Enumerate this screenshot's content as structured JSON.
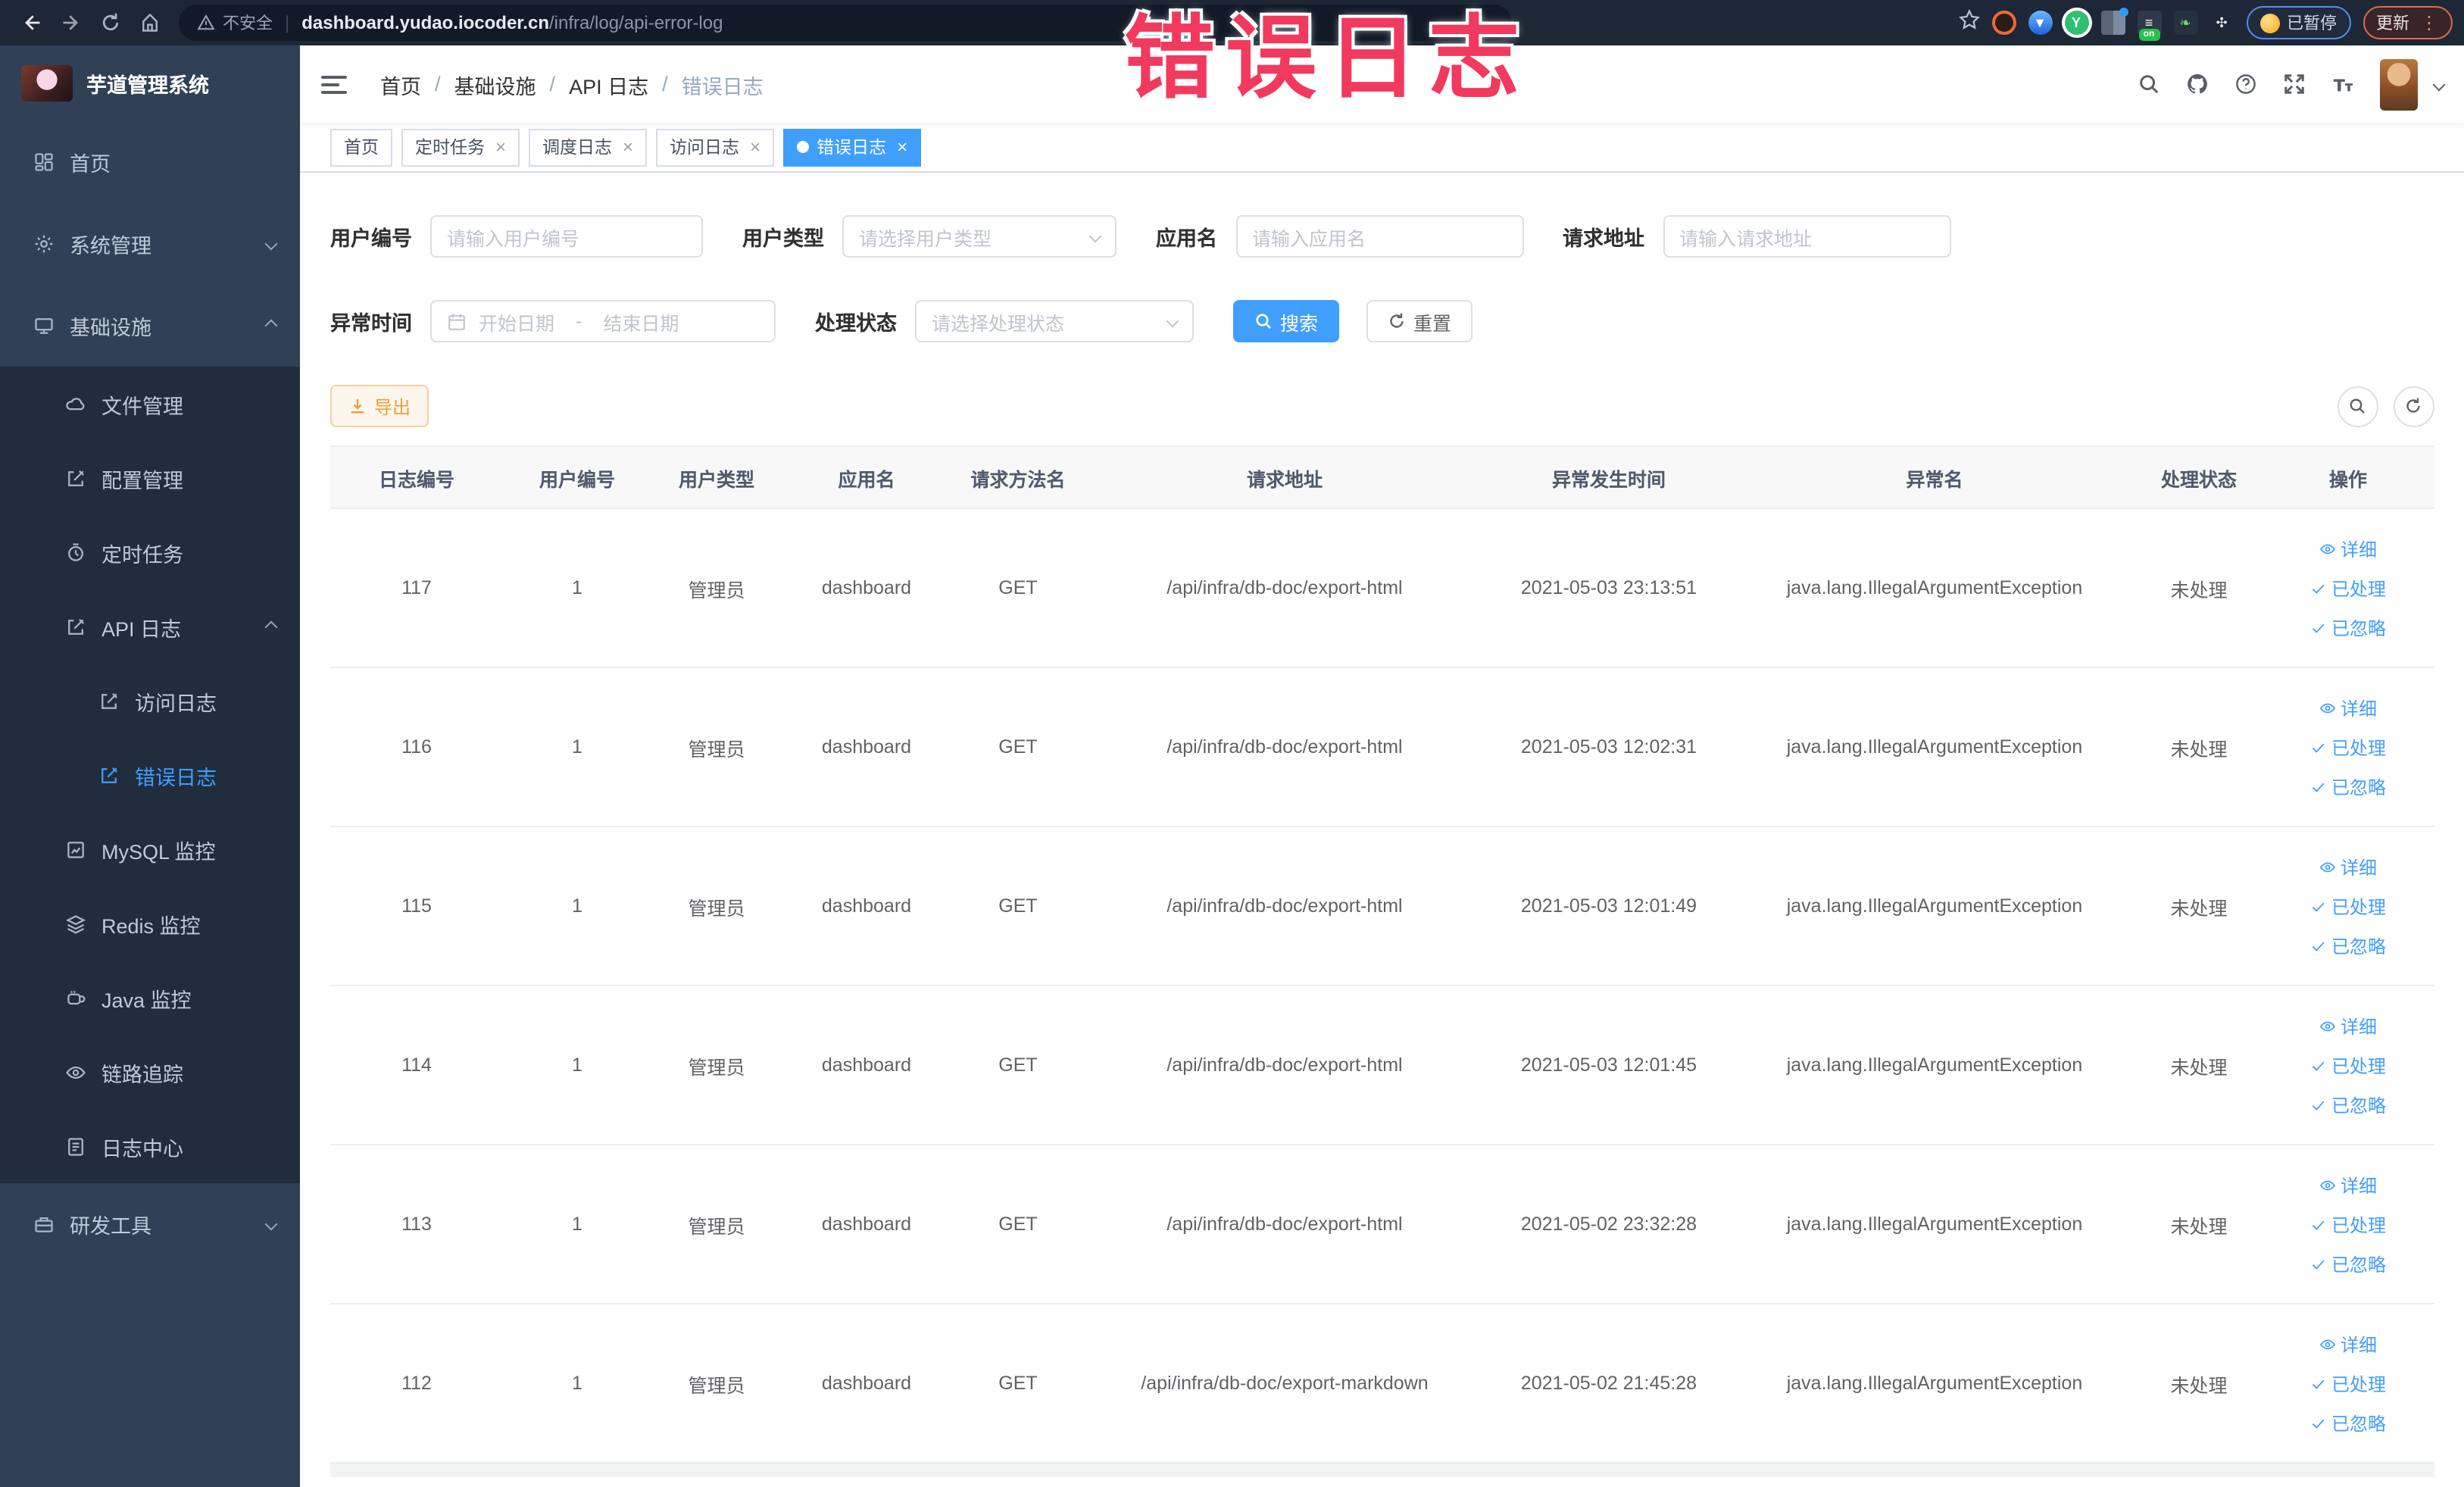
{
  "colors": {
    "accent": "#409eff",
    "warning": "#e6a23c",
    "stamp": "#f13a5e",
    "sidebar_bg": "#304156",
    "submenu_bg": "#1f2d3d"
  },
  "browser": {
    "security_label": "不安全",
    "url_domain": "dashboard.yudao.iocoder.cn",
    "url_path": "/infra/log/api-error-log",
    "paused_badge": "已暂停",
    "update_button": "更新"
  },
  "overlay_stamp": "错误日志",
  "sidebar": {
    "title": "芋道管理系统",
    "menu": [
      {
        "label": "首页",
        "icon": "dashboard-icon",
        "level": 1
      },
      {
        "label": "系统管理",
        "icon": "gear-icon",
        "level": 1,
        "chevron": "down"
      },
      {
        "label": "基础设施",
        "icon": "monitor-icon",
        "level": 1,
        "chevron": "up"
      },
      {
        "label": "文件管理",
        "icon": "cloud-icon",
        "level": 2
      },
      {
        "label": "配置管理",
        "icon": "edit-icon",
        "level": 2
      },
      {
        "label": "定时任务",
        "icon": "timer-icon",
        "level": 2
      },
      {
        "label": "API 日志",
        "icon": "edit-icon",
        "level": 2,
        "chevron": "up"
      },
      {
        "label": "访问日志",
        "icon": "edit-icon",
        "level": 3
      },
      {
        "label": "错误日志",
        "icon": "edit-icon",
        "level": 3,
        "active": true
      },
      {
        "label": "MySQL 监控",
        "icon": "database-icon",
        "level": 2
      },
      {
        "label": "Redis 监控",
        "icon": "layers-icon",
        "level": 2
      },
      {
        "label": "Java 监控",
        "icon": "coffee-icon",
        "level": 2
      },
      {
        "label": "链路追踪",
        "icon": "eye-icon",
        "level": 2
      },
      {
        "label": "日志中心",
        "icon": "doc-icon",
        "level": 2
      },
      {
        "label": "研发工具",
        "icon": "toolbox-icon",
        "level": 1,
        "chevron": "down"
      }
    ]
  },
  "breadcrumb": {
    "items": [
      "首页",
      "基础设施",
      "API 日志",
      "错误日志"
    ],
    "separator": "/"
  },
  "tags": [
    {
      "label": "首页",
      "closable": false,
      "active": false
    },
    {
      "label": "定时任务",
      "closable": true,
      "active": false
    },
    {
      "label": "调度日志",
      "closable": true,
      "active": false
    },
    {
      "label": "访问日志",
      "closable": true,
      "active": false
    },
    {
      "label": "错误日志",
      "closable": true,
      "active": true
    }
  ],
  "filters": {
    "user_id": {
      "label": "用户编号",
      "placeholder": "请输入用户编号"
    },
    "user_type": {
      "label": "用户类型",
      "placeholder": "请选择用户类型"
    },
    "app_name": {
      "label": "应用名",
      "placeholder": "请输入应用名"
    },
    "req_url": {
      "label": "请求地址",
      "placeholder": "请输入请求地址"
    },
    "exc_time": {
      "label": "异常时间",
      "start_placeholder": "开始日期",
      "separator": "-",
      "end_placeholder": "结束日期"
    },
    "status": {
      "label": "处理状态",
      "placeholder": "请选择处理状态"
    },
    "search_button": "搜索",
    "reset_button": "重置"
  },
  "toolbar": {
    "export_button": "导出"
  },
  "table": {
    "headers": [
      "日志编号",
      "用户编号",
      "用户类型",
      "应用名",
      "请求方法名",
      "请求地址",
      "异常发生时间",
      "异常名",
      "处理状态",
      "操作"
    ],
    "row_actions": [
      "详细",
      "已处理",
      "已忽略"
    ],
    "rows": [
      {
        "id": "117",
        "user_id": "1",
        "user_type": "管理员",
        "app": "dashboard",
        "method": "GET",
        "url": "/api/infra/db-doc/export-html",
        "time": "2021-05-03 23:13:51",
        "exception": "java.lang.IllegalArgumentException",
        "status": "未处理"
      },
      {
        "id": "116",
        "user_id": "1",
        "user_type": "管理员",
        "app": "dashboard",
        "method": "GET",
        "url": "/api/infra/db-doc/export-html",
        "time": "2021-05-03 12:02:31",
        "exception": "java.lang.IllegalArgumentException",
        "status": "未处理"
      },
      {
        "id": "115",
        "user_id": "1",
        "user_type": "管理员",
        "app": "dashboard",
        "method": "GET",
        "url": "/api/infra/db-doc/export-html",
        "time": "2021-05-03 12:01:49",
        "exception": "java.lang.IllegalArgumentException",
        "status": "未处理"
      },
      {
        "id": "114",
        "user_id": "1",
        "user_type": "管理员",
        "app": "dashboard",
        "method": "GET",
        "url": "/api/infra/db-doc/export-html",
        "time": "2021-05-03 12:01:45",
        "exception": "java.lang.IllegalArgumentException",
        "status": "未处理"
      },
      {
        "id": "113",
        "user_id": "1",
        "user_type": "管理员",
        "app": "dashboard",
        "method": "GET",
        "url": "/api/infra/db-doc/export-html",
        "time": "2021-05-02 23:32:28",
        "exception": "java.lang.IllegalArgumentException",
        "status": "未处理"
      },
      {
        "id": "112",
        "user_id": "1",
        "user_type": "管理员",
        "app": "dashboard",
        "method": "GET",
        "url": "/api/infra/db-doc/export-markdown",
        "time": "2021-05-02 21:45:28",
        "exception": "java.lang.IllegalArgumentException",
        "status": "未处理"
      }
    ]
  }
}
